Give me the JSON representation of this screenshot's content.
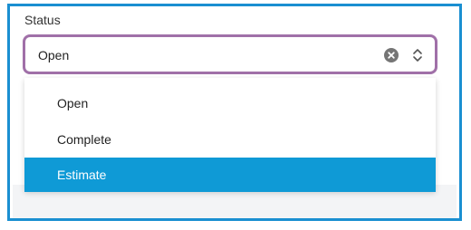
{
  "status_field": {
    "label": "Status",
    "value": "Open",
    "clear_icon": "clear-circle-x-icon",
    "toggle_icon": "up-down-chevron-icon"
  },
  "dropdown": {
    "options": [
      {
        "label": "Open"
      },
      {
        "label": "Complete"
      },
      {
        "label": "Estimate",
        "highlighted": true
      }
    ]
  },
  "colors": {
    "frame_border": "#1a8fd1",
    "select_border_focus": "#a070a8",
    "highlight_bg": "#0f9ad6",
    "highlight_text": "#ffffff"
  }
}
